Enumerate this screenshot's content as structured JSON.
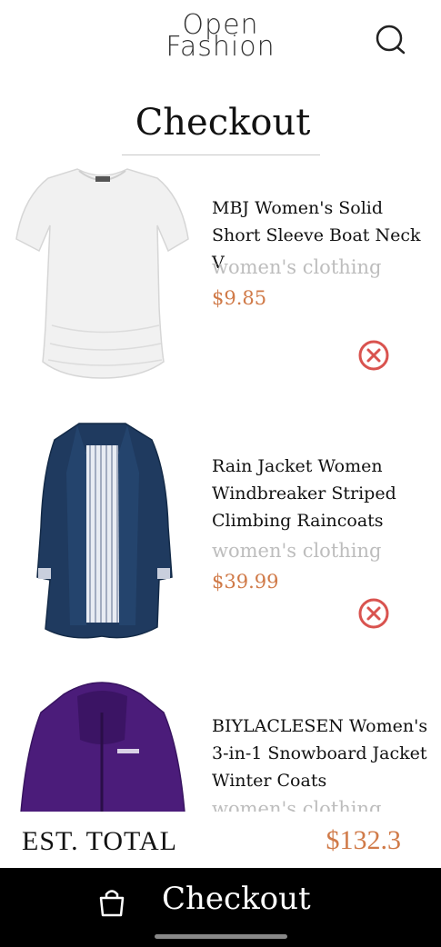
{
  "header": {
    "logo_line1": "Open",
    "logo_line2": "Fashion",
    "search_icon": "search-icon"
  },
  "page": {
    "title": "Checkout"
  },
  "items": [
    {
      "name": "MBJ Women's Solid Short Sleeve Boat Neck V",
      "category": "women's clothing",
      "price": "$9.85",
      "image_icon": "white-tshirt-image",
      "remove_icon": "remove-circle-icon",
      "remove_color": "#d9534f"
    },
    {
      "name": "Rain Jacket Women Windbreaker Striped Climbing Raincoats",
      "category": "women's clothing",
      "price": "$39.99",
      "image_icon": "navy-raincoat-image",
      "remove_icon": "remove-circle-icon",
      "remove_color": "#d9534f"
    },
    {
      "name": "BIYLACLESEN Women's 3-in-1 Snowboard Jacket Winter Coats",
      "category": "women's clothing",
      "price": "",
      "image_icon": "purple-jacket-image"
    }
  ],
  "total": {
    "label": "EST. TOTAL",
    "value": "$132.3"
  },
  "checkout_bar": {
    "label": "Checkout",
    "icon": "shopping-bag-icon"
  },
  "colors": {
    "accent": "#d07a48",
    "muted": "#bdbdbd",
    "bar": "#000000",
    "remove": "#d9534f"
  }
}
